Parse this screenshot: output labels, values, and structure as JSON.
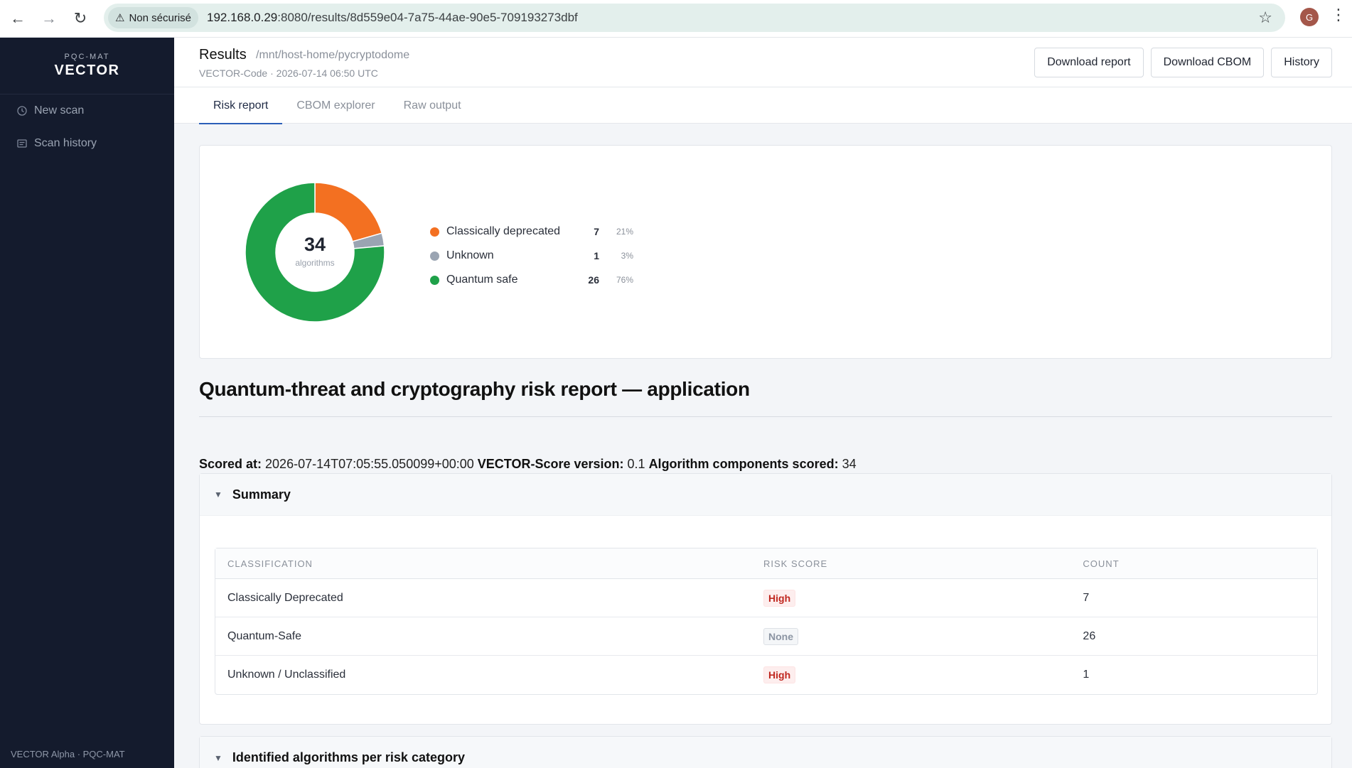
{
  "browser": {
    "security_label": "Non sécurisé",
    "url_host": "192.168.0.29",
    "url_rest": ":8080/results/8d559e04-7a75-44ae-90e5-709193273dbf",
    "avatar_letter": "G"
  },
  "sidebar": {
    "brand_sub": "PQC-MAT",
    "brand_main": "VECTOR",
    "items": [
      {
        "label": "New scan",
        "icon": "clock-icon"
      },
      {
        "label": "Scan history",
        "icon": "list-icon"
      }
    ],
    "footer": "VECTOR Alpha · PQC-MAT"
  },
  "header": {
    "title": "Results",
    "path": "/mnt/host-home/pycryptodome",
    "meta": "VECTOR-Code  · 2026-07-14 06:50 UTC",
    "actions": [
      "Download report",
      "Download CBOM",
      "History"
    ]
  },
  "tabs": [
    {
      "label": "Risk report",
      "active": true
    },
    {
      "label": "CBOM explorer",
      "active": false
    },
    {
      "label": "Raw output",
      "active": false
    }
  ],
  "overview": {
    "total": "34",
    "total_label": "algorithms",
    "legend": [
      {
        "label": "Classically deprecated",
        "count": "7",
        "pct": "21%",
        "value": 7,
        "color": "#f37021"
      },
      {
        "label": "Unknown",
        "count": "1",
        "pct": "3%",
        "value": 1,
        "color": "#9aa4b2"
      },
      {
        "label": "Quantum safe",
        "count": "26",
        "pct": "76%",
        "value": 26,
        "color": "#1fa149"
      }
    ]
  },
  "report": {
    "title": "Quantum-threat and cryptography risk report — application",
    "scored_at_label": "Scored at:",
    "scored_at_value": " 2026-07-14T07:05:55.050099+00:00 ",
    "version_label": "VECTOR-Score version:",
    "version_value": " 0.1 ",
    "components_label": "Algorithm components scored:",
    "components_value": " 34"
  },
  "summary": {
    "title": "Summary",
    "columns": [
      "CLASSIFICATION",
      "RISK SCORE",
      "COUNT"
    ],
    "rows": [
      {
        "classification": "Classically Deprecated",
        "risk": "High",
        "count": "7"
      },
      {
        "classification": "Quantum-Safe",
        "risk": "None",
        "count": "26"
      },
      {
        "classification": "Unknown / Unclassified",
        "risk": "High",
        "count": "1"
      }
    ]
  },
  "algorithms_section": {
    "title": "Identified algorithms per risk category"
  }
}
